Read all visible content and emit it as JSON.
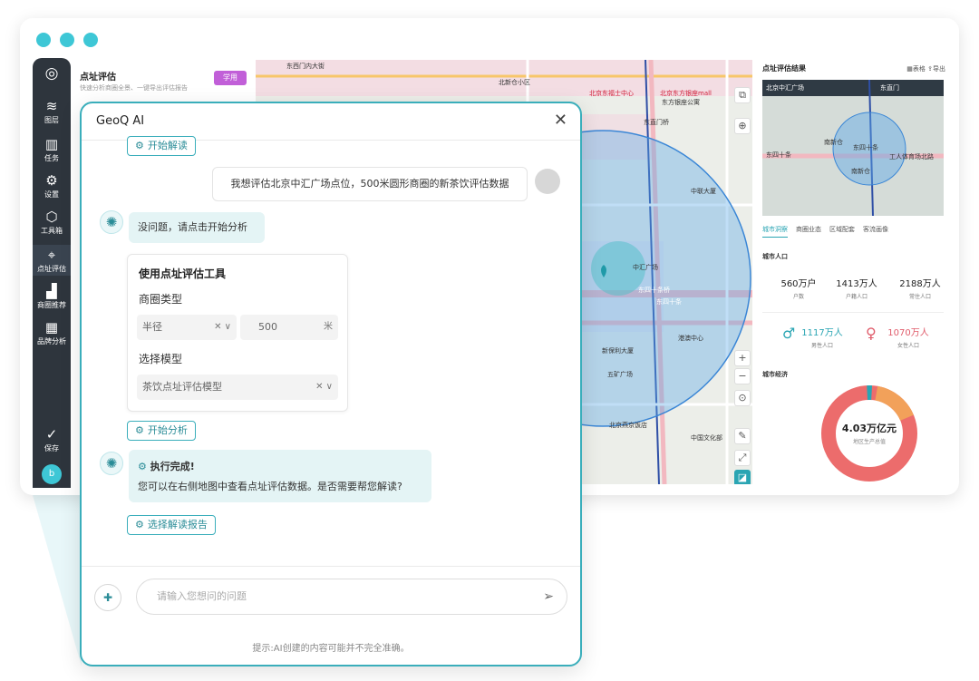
{
  "app": {
    "panel_title": "点址评估",
    "panel_subtitle": "快速分析商圈全景、一键导出评估报告",
    "panel_button": "学用"
  },
  "toolbar": [
    {
      "label": "图层",
      "icon": "layers-icon",
      "glyph": "≋"
    },
    {
      "label": "任务",
      "icon": "books-icon",
      "glyph": "▥"
    },
    {
      "label": "设置",
      "icon": "sliders-icon",
      "glyph": "⚙"
    },
    {
      "label": "工具箱",
      "icon": "cube-icon",
      "glyph": "⬡"
    },
    {
      "label": "点址评估",
      "icon": "location-icon",
      "glyph": "⌖"
    },
    {
      "label": "商圈推荐",
      "icon": "bar-chart-icon",
      "glyph": "▟"
    },
    {
      "label": "品牌分析",
      "icon": "grid-icon",
      "glyph": "▦"
    },
    {
      "label": "保存",
      "icon": "check-circle-icon",
      "glyph": "✓"
    }
  ],
  "avatar_letter": "b",
  "map_labels": [
    "东西门内大街",
    "北新仓小区",
    "北京东福士中心",
    "北京东方银座mall",
    "东方银座公寓",
    "东直门桥",
    "中联大厦",
    "东四十条桥",
    "东四十条",
    "港澳中心",
    "新保利大厦",
    "五矿广场",
    "北京燕京饭店",
    "中国文化部",
    "东四十条",
    "北京保利剧院",
    "工人体育场北路",
    "中汇广场"
  ],
  "result_panel": {
    "title": "点址评估结果",
    "actions": "▦表格  ⇪导出",
    "mini_map_labels": [
      "北京中汇广场",
      "东直门",
      "东四十条",
      "东四十条",
      "工人体育场北路",
      "南新仓",
      "南新仓"
    ],
    "tabs": [
      "城市洞察",
      "商圈业态",
      "区域配套",
      "客流画像"
    ],
    "section_population": "城市人口",
    "stats": [
      {
        "value": "560万户",
        "label": "户数"
      },
      {
        "value": "1413万人",
        "label": "户籍人口"
      },
      {
        "value": "2188万人",
        "label": "常住人口"
      }
    ],
    "male": {
      "value": "1117万人",
      "label": "男性人口"
    },
    "female": {
      "value": "1070万人",
      "label": "女性人口"
    },
    "section_economy": "城市经济",
    "gdp_value": "4.03万亿元",
    "gdp_label": "地区生产总值",
    "colors": {
      "accent": "#2aa5b3",
      "male": "#2aa5b3",
      "female": "#e05c6b",
      "donut_main": "#ec6c6c",
      "donut_orange": "#f2a15a",
      "donut_teal": "#2aa5b3"
    }
  },
  "dialog": {
    "title": "GeoQ AI",
    "start_reading": "开始解读",
    "user_message": "我想评估北京中汇广场点位，500米圆形商圈的新茶饮评估数据",
    "bot_reply_1": "没问题，请点击开始分析",
    "tool": {
      "title": "使用点址评估工具",
      "label_type": "商圈类型",
      "select_type": "半径",
      "radius_value": "500",
      "radius_unit": "米",
      "label_model": "选择模型",
      "select_model": "茶饮点址评估模型"
    },
    "start_analysis": "开始分析",
    "done_title": "执行完成!",
    "done_text": "您可以在右侧地图中查看点址评估数据。是否需要帮您解读?",
    "choose_report": "选择解读报告",
    "input_placeholder": "请输入您想问的问题",
    "disclaimer": "提示:AI创建的内容可能并不完全准确。"
  }
}
